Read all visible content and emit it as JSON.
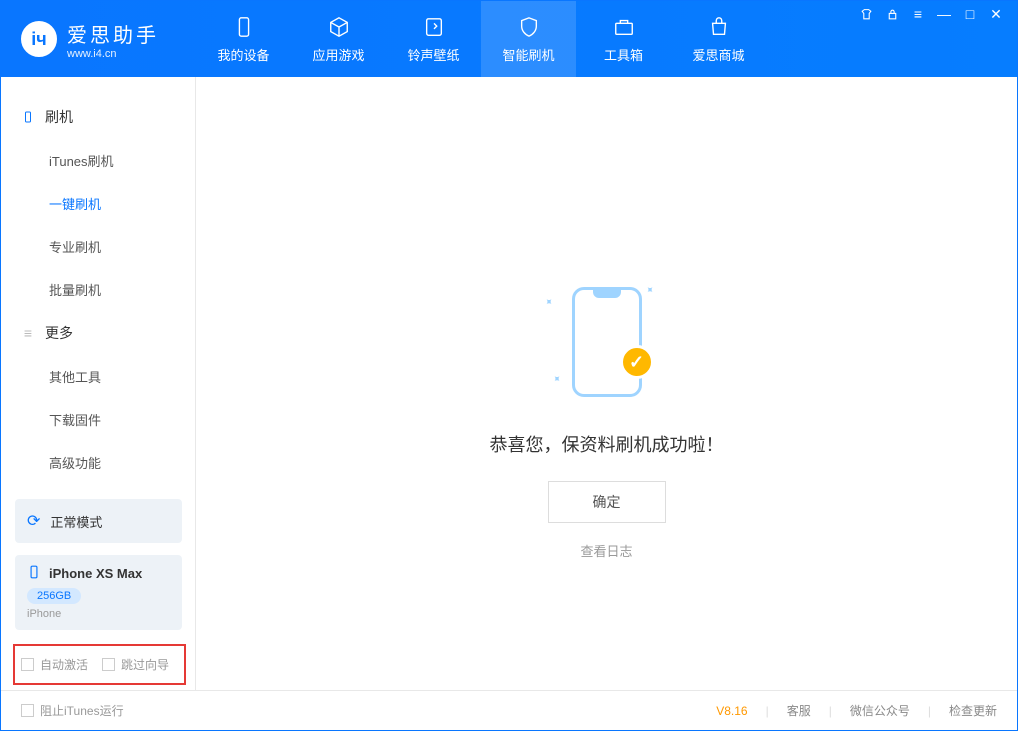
{
  "app": {
    "title": "爱思助手",
    "subtitle": "www.i4.cn"
  },
  "nav": {
    "tabs": [
      {
        "label": "我的设备",
        "icon": "device"
      },
      {
        "label": "应用游戏",
        "icon": "cube"
      },
      {
        "label": "铃声壁纸",
        "icon": "music"
      },
      {
        "label": "智能刷机",
        "icon": "shield"
      },
      {
        "label": "工具箱",
        "icon": "toolbox"
      },
      {
        "label": "爱思商城",
        "icon": "bag"
      }
    ]
  },
  "sidebar": {
    "section1": {
      "title": "刷机",
      "items": [
        "iTunes刷机",
        "一键刷机",
        "专业刷机",
        "批量刷机"
      ]
    },
    "section2": {
      "title": "更多",
      "items": [
        "其他工具",
        "下载固件",
        "高级功能"
      ]
    },
    "mode": "正常模式",
    "device": {
      "name": "iPhone XS Max",
      "storage": "256GB",
      "type": "iPhone"
    },
    "checks": {
      "auto_activate": "自动激活",
      "skip_guide": "跳过向导"
    }
  },
  "main": {
    "success_message": "恭喜您，保资料刷机成功啦！",
    "ok_button": "确定",
    "view_log": "查看日志"
  },
  "footer": {
    "block_itunes": "阻止iTunes运行",
    "version": "V8.16",
    "links": [
      "客服",
      "微信公众号",
      "检查更新"
    ]
  }
}
